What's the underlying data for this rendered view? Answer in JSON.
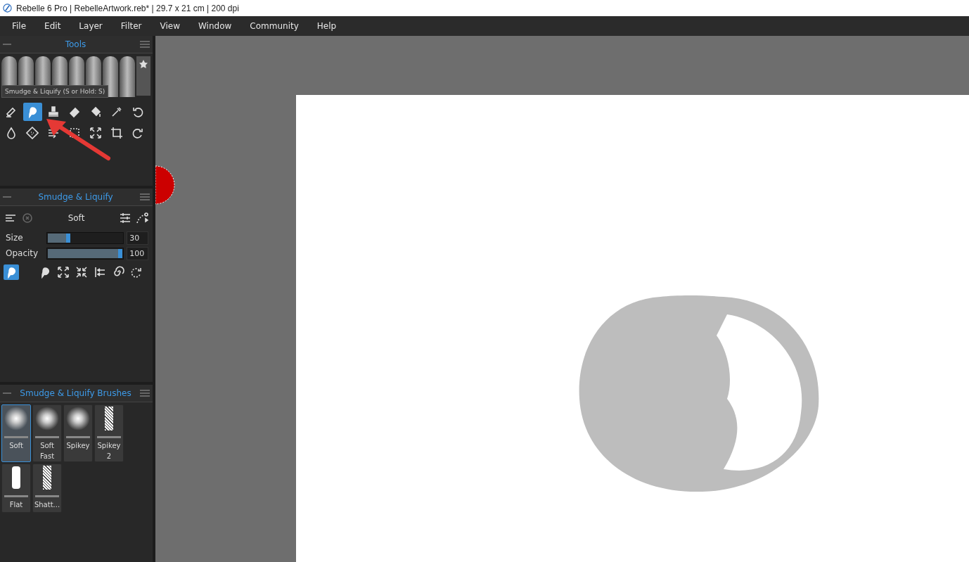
{
  "window": {
    "title": "Rebelle 6 Pro | RebelleArtwork.reb* | 29.7 x 21 cm | 200 dpi"
  },
  "menu": [
    "File",
    "Edit",
    "Layer",
    "Filter",
    "View",
    "Window",
    "Community",
    "Help"
  ],
  "tools_panel": {
    "title": "Tools",
    "tooltip": "Smudge & Liquify (S or Hold: S)",
    "tools": [
      {
        "kind": "pencil-eraser",
        "selected": false
      },
      {
        "kind": "smudge",
        "selected": true
      },
      {
        "kind": "stamp",
        "selected": false
      },
      {
        "kind": "eraser",
        "selected": false
      },
      {
        "kind": "bucket",
        "selected": false
      },
      {
        "kind": "dropper",
        "selected": false
      },
      {
        "kind": "undo",
        "selected": false
      },
      {
        "kind": "drop",
        "selected": false
      },
      {
        "kind": "tile",
        "selected": false
      },
      {
        "kind": "blow",
        "selected": false
      },
      {
        "kind": "select",
        "selected": false
      },
      {
        "kind": "transform",
        "selected": false
      },
      {
        "kind": "crop",
        "selected": false
      },
      {
        "kind": "redo",
        "selected": false
      }
    ]
  },
  "smudge_panel": {
    "title": "Smudge & Liquify",
    "preset": "Soft",
    "sliders": [
      {
        "label": "Size",
        "level": 0.3,
        "reading": "30"
      },
      {
        "label": "Opacity",
        "level": 1.0,
        "reading": "100"
      }
    ],
    "modes": [
      {
        "kind": "smudge",
        "selected": true
      },
      {
        "kind": "smudge-alt",
        "selected": false
      },
      {
        "kind": "expand",
        "selected": false
      },
      {
        "kind": "shrink",
        "selected": false
      },
      {
        "kind": "push",
        "selected": false
      },
      {
        "kind": "swirl",
        "selected": false
      },
      {
        "kind": "rotate",
        "selected": false
      }
    ]
  },
  "brushes_panel": {
    "title": "Smudge & Liquify Brushes",
    "brushes": [
      {
        "label": "Soft",
        "kind": "soft",
        "selected": true
      },
      {
        "label": "Soft Fast",
        "kind": "soft",
        "selected": false
      },
      {
        "label": "Spikey",
        "kind": "soft",
        "selected": false
      },
      {
        "label": "Spikey 2",
        "kind": "grain",
        "selected": false
      },
      {
        "label": "Flat",
        "kind": "flat",
        "selected": false
      },
      {
        "label": "Shatt...",
        "kind": "grain",
        "selected": false
      }
    ]
  }
}
